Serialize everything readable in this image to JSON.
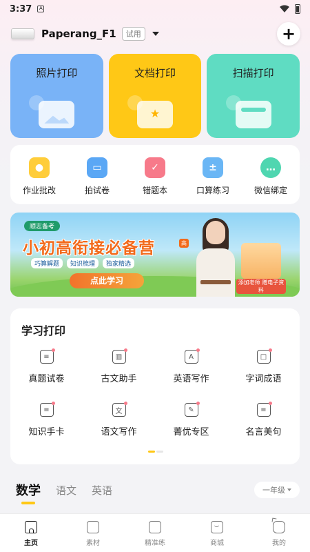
{
  "status_bar": {
    "time": "3:37",
    "notification": "A"
  },
  "header": {
    "device_name": "Paperang_F1",
    "trial_badge": "试用",
    "add_label": "+"
  },
  "print_cards": [
    {
      "label": "照片打印"
    },
    {
      "label": "文档打印"
    },
    {
      "label": "扫描打印"
    }
  ],
  "tools": [
    {
      "label": "作业批改"
    },
    {
      "label": "拍试卷"
    },
    {
      "label": "错题本"
    },
    {
      "label": "口算练习"
    },
    {
      "label": "微信绑定"
    }
  ],
  "banner": {
    "chip": "顺志备考",
    "headline": "小初高衔接必备营",
    "tags": [
      "巧算解题",
      "知识梳理",
      "独家精选"
    ],
    "cta": "点此学习",
    "gift_label": "添加老师 赠电子资料",
    "vlabel": "高"
  },
  "study": {
    "title": "学习打印",
    "items": [
      {
        "label": "真题试卷",
        "icon": "≡"
      },
      {
        "label": "古文助手",
        "icon": "▥"
      },
      {
        "label": "英语写作",
        "icon": "A"
      },
      {
        "label": "字词成语",
        "icon": "□"
      },
      {
        "label": "知识手卡",
        "icon": "≡"
      },
      {
        "label": "语文写作",
        "icon": "文"
      },
      {
        "label": "菁优专区",
        "icon": "✎"
      },
      {
        "label": "名言美句",
        "icon": "≡"
      }
    ]
  },
  "subject_tabs": [
    {
      "label": "数学"
    },
    {
      "label": "语文"
    },
    {
      "label": "英语"
    }
  ],
  "grade_select": {
    "value": "一年级"
  },
  "bottom_nav": [
    {
      "label": "主页"
    },
    {
      "label": "素材"
    },
    {
      "label": "精准练"
    },
    {
      "label": "商城"
    },
    {
      "label": "我的"
    }
  ]
}
